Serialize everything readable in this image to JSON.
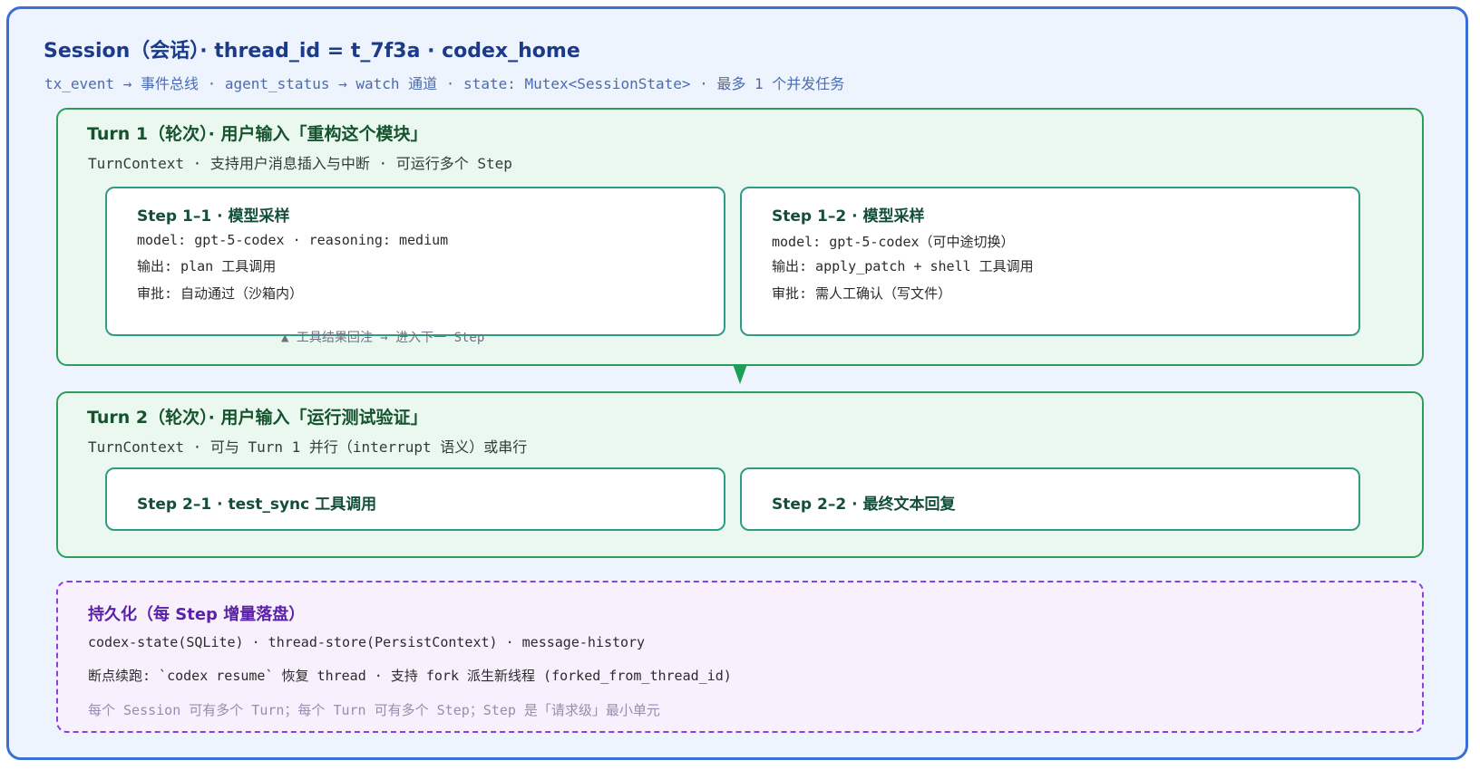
{
  "session": {
    "title": "Session（会话）· thread_id = t_7f3a · codex_home",
    "subtitle": "tx_event → 事件总线 · agent_status → watch 通道 · state: Mutex<SessionState> · 最多 1 个并发任务"
  },
  "turn1": {
    "title": "Turn 1（轮次）· 用户输入「重构这个模块」",
    "subtitle": "TurnContext · 支持用户消息插入与中断 · 可运行多个 Step",
    "step1": {
      "title": "Step 1–1 · 模型采样",
      "line1": "model: gpt-5-codex · reasoning: medium",
      "line2": "输出: plan 工具调用",
      "line3": "审批: 自动通过（沙箱内）"
    },
    "step2": {
      "title": "Step 1–2 · 模型采样",
      "line1": "model: gpt-5-codex（可中途切换）",
      "line2": "输出: apply_patch + shell 工具调用",
      "line3": "审批: 需人工确认（写文件）"
    },
    "feedback_hint": "▲ 工具结果回注 → 进入下一 Step"
  },
  "turn2": {
    "title": "Turn 2（轮次）· 用户输入「运行测试验证」",
    "subtitle": "TurnContext · 可与 Turn 1 并行（interrupt 语义）或串行",
    "step1": {
      "title": "Step 2–1 · test_sync 工具调用"
    },
    "step2": {
      "title": "Step 2–2 · 最终文本回复"
    }
  },
  "persistence": {
    "title": "持久化（每 Step 增量落盘）",
    "line1": "codex-state(SQLite) · thread-store(PersistContext) · message-history",
    "line2": "断点续跑: `codex resume` 恢复 thread · 支持 fork 派生新线程 (forked_from_thread_id)",
    "note": "每个 Session 可有多个 Turn；每个 Turn 可有多个 Step；Step 是「请求级」最小单元"
  },
  "colors": {
    "session_border": "#3b6fd8",
    "turn_border": "#2e9d5b",
    "step_border": "#2f9c86",
    "persist_border": "#8b3fe0",
    "arrow": "#1f9c55"
  }
}
